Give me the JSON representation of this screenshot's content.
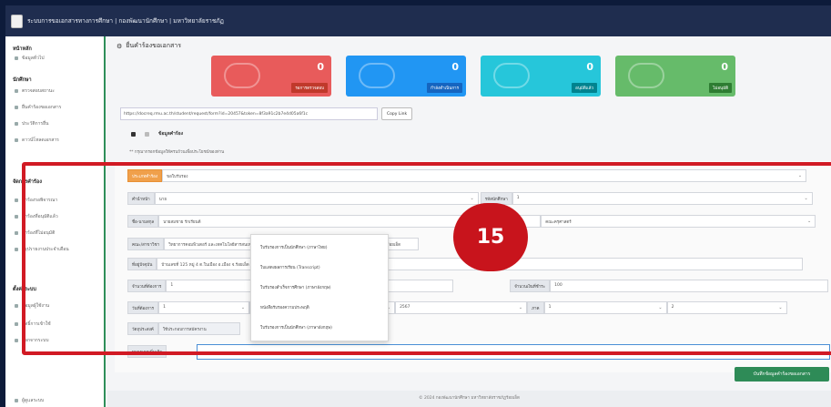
{
  "topbar": {
    "title": "ระบบการขอเอกสารทางการศึกษา | กองพัฒนานักศึกษา | มหาวิทยาลัยราชภัฏ"
  },
  "sidebar": {
    "sections": [
      {
        "title": "หน้าหลัก",
        "items": [
          "ข้อมูลทั่วไป"
        ]
      },
      {
        "title": "นักศึกษา",
        "items": [
          "ตรวจสอบสถานะ",
          "ยื่นคำร้องขอเอกสาร",
          "ประวัติการยื่น",
          "ดาวน์โหลดเอกสาร"
        ]
      },
      {
        "title": "จัดการคำร้อง",
        "items": [
          "คำร้องรอพิจารณา",
          "คำร้องที่อนุมัติแล้ว",
          "คำร้องที่ไม่อนุมัติ",
          "สรุปรายงานประจำเดือน"
        ]
      },
      {
        "title": "ตั้งค่าระบบ",
        "items": [
          "ข้อมูลผู้ใช้งาน",
          "สิทธิ์การเข้าใช้",
          "ออกจากระบบ"
        ]
      }
    ],
    "footer_item": "ผู้ดูแลระบบ"
  },
  "main": {
    "page_title": "ยื่นคำร้องขอเอกสาร",
    "cards": [
      {
        "value": "0",
        "label": "รอการตรวจสอบ",
        "color": "#e85b5b",
        "tag_color": "#c0392b",
        "icon": "users-icon"
      },
      {
        "value": "0",
        "label": "กำลังดำเนินการ",
        "color": "#2196f3",
        "tag_color": "#1565c0",
        "icon": "document-icon"
      },
      {
        "value": "0",
        "label": "อนุมัติแล้ว",
        "color": "#26c6da",
        "tag_color": "#00838f",
        "icon": "check-icon"
      },
      {
        "value": "0",
        "label": "ไม่อนุมัติ",
        "color": "#66bb6a",
        "tag_color": "#2e7d32",
        "icon": "user-icon"
      }
    ],
    "share_url": "https://docreq.rmu.ac.th/student/request/form?id=20457&token=8f3a91c2b7e4d05a6f1c",
    "copy_label": "Copy Link",
    "tab_title": "ข้อมูลคำร้อง",
    "hint": "** กรุณากรอกข้อมูลให้ครบถ้วนเพื่อประโยชน์ของท่าน"
  },
  "form": {
    "request_type": {
      "label": "ประเภทคำร้อง",
      "value": "ขอใบรับรอง"
    },
    "prefix": {
      "label": "คำนำหน้า",
      "value": "นาย"
    },
    "student_code": {
      "label": "รหัสนักศึกษา",
      "value": "1"
    },
    "name": {
      "label": "ชื่อ-นามสกุล",
      "value": "นายสมชาย รักเรียนดี"
    },
    "program": {
      "value": "คณะครุศาสตร์"
    },
    "faculty": {
      "label": "คณะ/สาขาวิชา",
      "value": "วิทยาการคอมพิวเตอร์ และเทคโนโลยีสารสนเทศ"
    },
    "phone_row": {
      "label": "ที่อยู่ปัจจุบัน",
      "value": "ร้อยเอ็ด"
    },
    "email": {
      "label": "อีเมล",
      "value": "บ้านเลขที่ 125 หมู่ 4 ต.ในเมือง อ.เมือง จ.ร้อยเอ็ด"
    },
    "copies": {
      "label": "จำนวนที่ต้องการ",
      "value": "1"
    },
    "amount": {
      "label": "จำนวนเงินที่ชำระ",
      "value": "100"
    },
    "pickup": {
      "label": "วันที่ต้องการ",
      "value": "1",
      "month": "มิถุนายน",
      "year_label": "ปีการศึกษา",
      "year": "2567",
      "term_label": "ภาค",
      "term": "1",
      "extra": "2"
    },
    "purpose": {
      "label": "วัตถุประสงค์",
      "value": "ใช้ประกอบการสมัครงาน"
    },
    "note": {
      "label": "หมายเหตุเพิ่มเติม"
    },
    "dropdown_options": [
      "ใบรับรองการเป็นนักศึกษา (ภาษาไทย)",
      "ใบแสดงผลการเรียน (Transcript)",
      "ใบรับรองสำเร็จการศึกษา (ภาษาอังกฤษ)",
      "หนังสือรับรองความประพฤติ",
      "ใบรับรองการเป็นนักศึกษา (ภาษาอังกฤษ)"
    ],
    "save_label": "บันทึกข้อมูลคำร้องขอเอกสาร"
  },
  "footer": {
    "text": "© 2024 กองพัฒนานักศึกษา มหาวิทยาลัยราชภัฏร้อยเอ็ด"
  },
  "annotation": {
    "step": "15"
  }
}
